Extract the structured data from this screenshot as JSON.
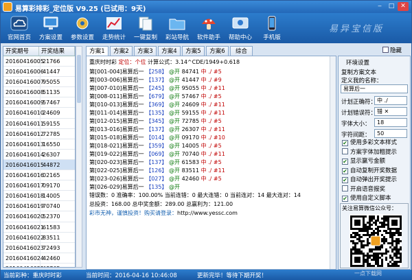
{
  "window": {
    "title": "易算彩排彩_定位版 V9.25 (已试用：9天)",
    "minimize": "‒",
    "maximize": "□",
    "close": "✕"
  },
  "toolbar": {
    "items": [
      {
        "label": "官网首页",
        "icon": "cloud-icon"
      },
      {
        "label": "方案设置",
        "icon": "monitor-icon"
      },
      {
        "label": "参数设置",
        "icon": "gear-icon"
      },
      {
        "label": "走势统计",
        "icon": "chart-icon"
      },
      {
        "label": "一键复制",
        "icon": "copy-icon"
      },
      {
        "label": "彩站导航",
        "icon": "folder-icon"
      },
      {
        "label": "软件助手",
        "icon": "mushroom-icon"
      },
      {
        "label": "帮助中心",
        "icon": "help-icon"
      },
      {
        "label": "手机版",
        "icon": "phone-icon"
      }
    ],
    "brand_text": "易异宝信版"
  },
  "history": {
    "headers": [
      "开奖期号",
      "开奖结果"
    ],
    "rows": [
      [
        "20160416005",
        "21766"
      ],
      [
        "20160416006",
        "41447"
      ],
      [
        "20160416007",
        "95055"
      ],
      [
        "20160416008",
        "51135"
      ],
      [
        "20160416009",
        "57467"
      ],
      [
        "20160416010",
        "24609"
      ],
      [
        "20160416011",
        "59155"
      ],
      [
        "20160416012",
        "72785"
      ],
      [
        "20160416013",
        "16550"
      ],
      [
        "20160416014",
        "26307"
      ],
      [
        "20160416015",
        "44872"
      ],
      [
        "20160416016",
        "02165"
      ],
      [
        "20160416017",
        "09170"
      ],
      [
        "20160416018",
        "14005"
      ],
      [
        "20160416019",
        "70740"
      ],
      [
        "20160416020",
        "52370"
      ],
      [
        "20160416021",
        "61583"
      ],
      [
        "20160416022",
        "83511"
      ],
      [
        "20160416023",
        "72493"
      ],
      [
        "20160416024",
        "42460"
      ],
      [
        "20160416025",
        "48765"
      ],
      [
        "20160416026",
        ""
      ]
    ]
  },
  "tabs": [
    "方案1",
    "方案2",
    "方案3",
    "方案4",
    "方案5",
    "方案6",
    "综合"
  ],
  "main": {
    "header": {
      "name": "重庆时时彩",
      "pos_label": "定位：",
      "pos_value": "个位",
      "formula": "计算公式：3.14^CDE/1949+0.618"
    },
    "rows": [
      {
        "range": "第[001-004]易算后一",
        "code": "【258】",
        "ret": "@开",
        "draw": "84741",
        "mark": "中 ./",
        "n": "#5"
      },
      {
        "range": "第[003-006]易算后一",
        "code": "【137】",
        "ret": "@开",
        "draw": "41447",
        "mark": "中 ./",
        "n": "#9"
      },
      {
        "range": "第[007-010]易算后一",
        "code": "【245】",
        "ret": "@开",
        "draw": "95055",
        "mark": "中 ./",
        "n": "#11"
      },
      {
        "range": "第[008-011]易算后一",
        "code": "【679】",
        "ret": "@开",
        "draw": "57467",
        "mark": "中 ./",
        "n": "#5"
      },
      {
        "range": "第[010-013]易算后一",
        "code": "【369】",
        "ret": "@开",
        "draw": "24609",
        "mark": "中 ./",
        "n": "#11"
      },
      {
        "range": "第[011-014]易算后一",
        "code": "【135】",
        "ret": "@开",
        "draw": "59155",
        "mark": "中 ./",
        "n": "#11"
      },
      {
        "range": "第[012-015]易算后一",
        "code": "【345】",
        "ret": "@开",
        "draw": "72785",
        "mark": "中 ./",
        "n": "#5"
      },
      {
        "range": "第[013-016]易算后一",
        "code": "【137】",
        "ret": "@开",
        "draw": "26307",
        "mark": "中 ./",
        "n": "#11"
      },
      {
        "range": "第[015-018]易算后一",
        "code": "【014】",
        "ret": "@开",
        "draw": "09170",
        "mark": "中 ./",
        "n": "#10"
      },
      {
        "range": "第[018-021]易算后一",
        "code": "【359】",
        "ret": "@开",
        "draw": "14005",
        "mark": "中 ./",
        "n": "#5"
      },
      {
        "range": "第[019-022]易算后一",
        "code": "【069】",
        "ret": "@开",
        "draw": "70740",
        "mark": "中 ./",
        "n": "#11"
      },
      {
        "range": "第[020-023]易算后一",
        "code": "【137】",
        "ret": "@开",
        "draw": "61583",
        "mark": "中 ./",
        "n": "#5"
      },
      {
        "range": "第[022-025]易算后一",
        "code": "【126】",
        "ret": "@开",
        "draw": "83511",
        "mark": "中 ./",
        "n": "#11"
      },
      {
        "range": "第[023-026]易算后一",
        "code": "【027】",
        "ret": "@开",
        "draw": "42460",
        "mark": "中 ./",
        "n": "#5"
      },
      {
        "range": "第[026-029]易算后一",
        "code": "【135】",
        "ret": "@开",
        "draw": "",
        "mark": "",
        "n": ""
      }
    ],
    "stats1": "错误数：0 准确率：100.00% 当前连错：0 最大连错：0 当前连对：14 最大连对：14",
    "stats2": "总投资：168.00 总中奖金额：289.00 总赢利为：121.00",
    "footer_prefix": "彩市无神，谨慎投资！购买请登录：",
    "footer_url": "http://www.yessc.com"
  },
  "hide_label": "隐藏",
  "settings": {
    "title": "环境设置",
    "copy_text": "复制方案文本",
    "define_label": "定义我的名称：",
    "define_value": "易算后一",
    "correct_label": "计划正确符：",
    "correct_value": "中 ./",
    "wrong_label": "计划错误符：",
    "wrong_value": "错 ✕",
    "fontsize_label": "字体大小：",
    "fontsize_value": "18",
    "spacing_label": "字符间距：",
    "spacing_value": "50",
    "checkboxes": [
      {
        "label": "使用多彩文本样式",
        "checked": true
      },
      {
        "label": "方案字体加粗提示",
        "checked": false
      },
      {
        "label": "显示赢亏金额",
        "checked": true
      },
      {
        "label": "自动复制开奖数据",
        "checked": true
      },
      {
        "label": "自动弹出开奖提示",
        "checked": true
      },
      {
        "label": "开启语音报奖",
        "checked": false
      },
      {
        "label": "使用自定义脚本",
        "checked": true
      }
    ],
    "wechat": "关注易算微信公众号："
  },
  "status": {
    "lottery": "当前彩种：重庆时时彩",
    "time": "当前时间：2016-04-16 10:46:08",
    "update": "更新完毕！等待下期开奖！"
  },
  "watermark": "一点下载网"
}
